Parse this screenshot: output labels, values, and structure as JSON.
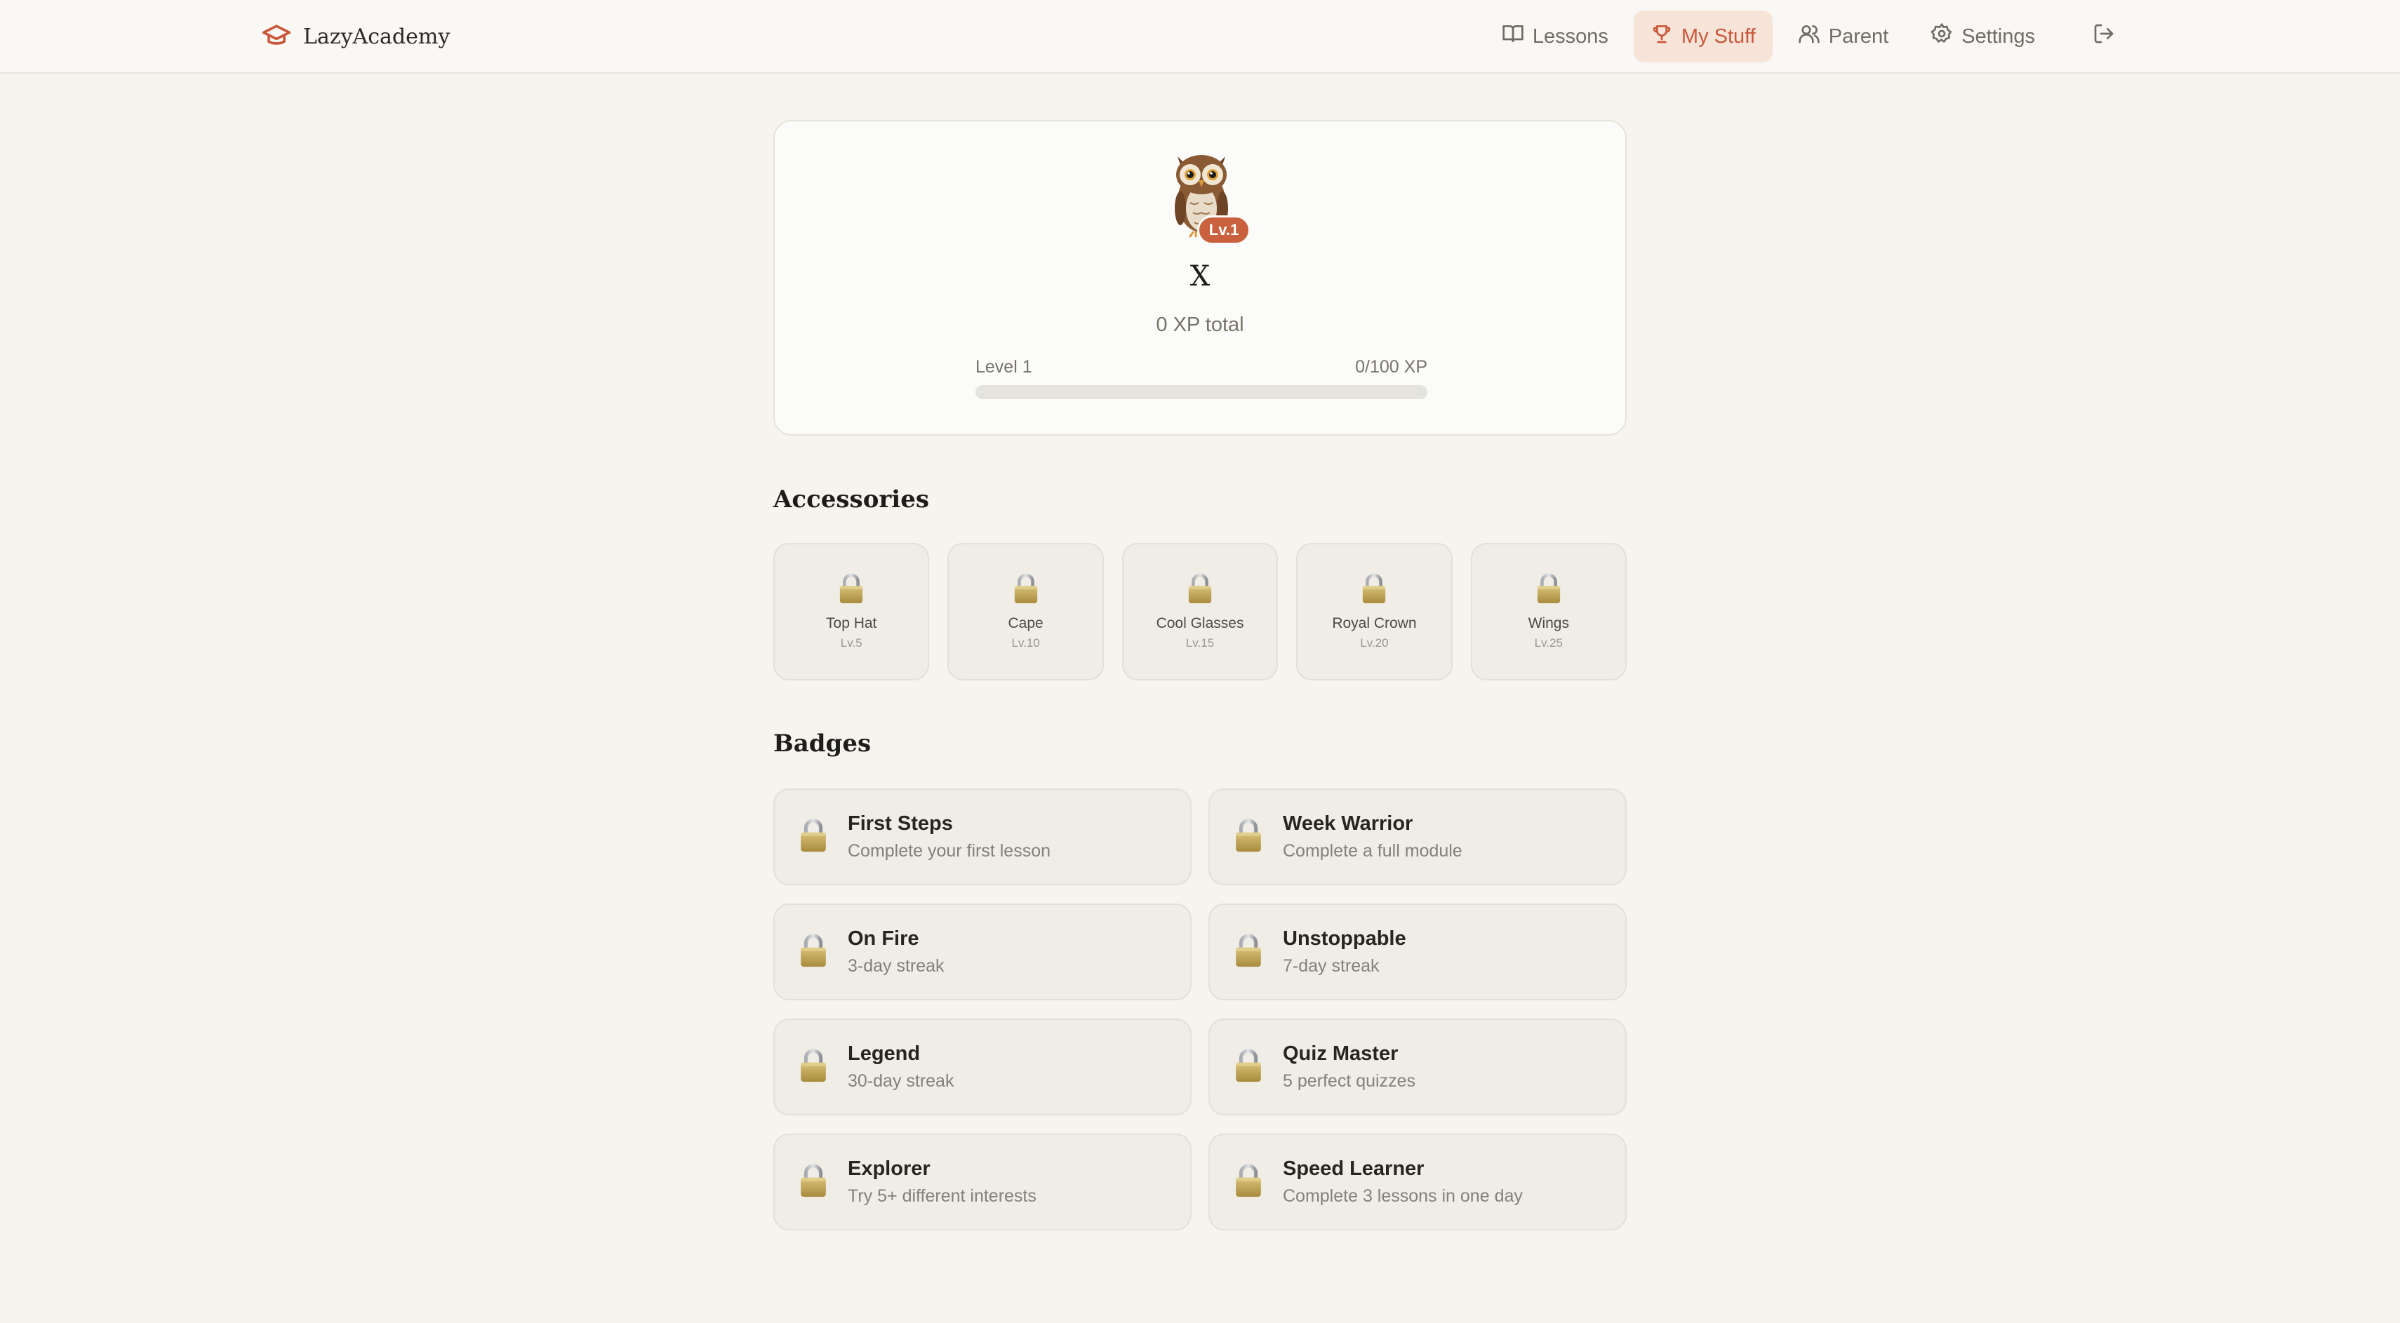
{
  "app": {
    "name": "LazyAcademy",
    "brand_color": "#c9573a"
  },
  "nav": {
    "items": [
      {
        "label": "Lessons",
        "icon": "book-icon"
      },
      {
        "label": "My Stuff",
        "icon": "trophy-icon",
        "active": true
      },
      {
        "label": "Parent",
        "icon": "users-icon"
      },
      {
        "label": "Settings",
        "icon": "gear-icon"
      }
    ],
    "logout_icon": "logout-icon"
  },
  "profile": {
    "avatar": "owl-icon",
    "level_badge": "Lv.1",
    "name": "X",
    "xp_total": "0 XP total",
    "level_label": "Level 1",
    "xp_progress_label": "0/100 XP",
    "xp_progress": 0.0
  },
  "accessories": {
    "title": "Accessories",
    "items": [
      {
        "name": "Top Hat",
        "level": "Lv.5",
        "locked": true
      },
      {
        "name": "Cape",
        "level": "Lv.10",
        "locked": true
      },
      {
        "name": "Cool Glasses",
        "level": "Lv.15",
        "locked": true
      },
      {
        "name": "Royal Crown",
        "level": "Lv.20",
        "locked": true
      },
      {
        "name": "Wings",
        "level": "Lv.25",
        "locked": true
      }
    ]
  },
  "badges": {
    "title": "Badges",
    "items": [
      {
        "name": "First Steps",
        "desc": "Complete your first lesson",
        "locked": true
      },
      {
        "name": "Week Warrior",
        "desc": "Complete a full module",
        "locked": true
      },
      {
        "name": "On Fire",
        "desc": "3-day streak",
        "locked": true
      },
      {
        "name": "Unstoppable",
        "desc": "7-day streak",
        "locked": true
      },
      {
        "name": "Legend",
        "desc": "30-day streak",
        "locked": true
      },
      {
        "name": "Quiz Master",
        "desc": "5 perfect quizzes",
        "locked": true
      },
      {
        "name": "Explorer",
        "desc": "Try 5+ different interests",
        "locked": true
      },
      {
        "name": "Speed Learner",
        "desc": "Complete 3 lessons in one day",
        "locked": true
      }
    ]
  }
}
